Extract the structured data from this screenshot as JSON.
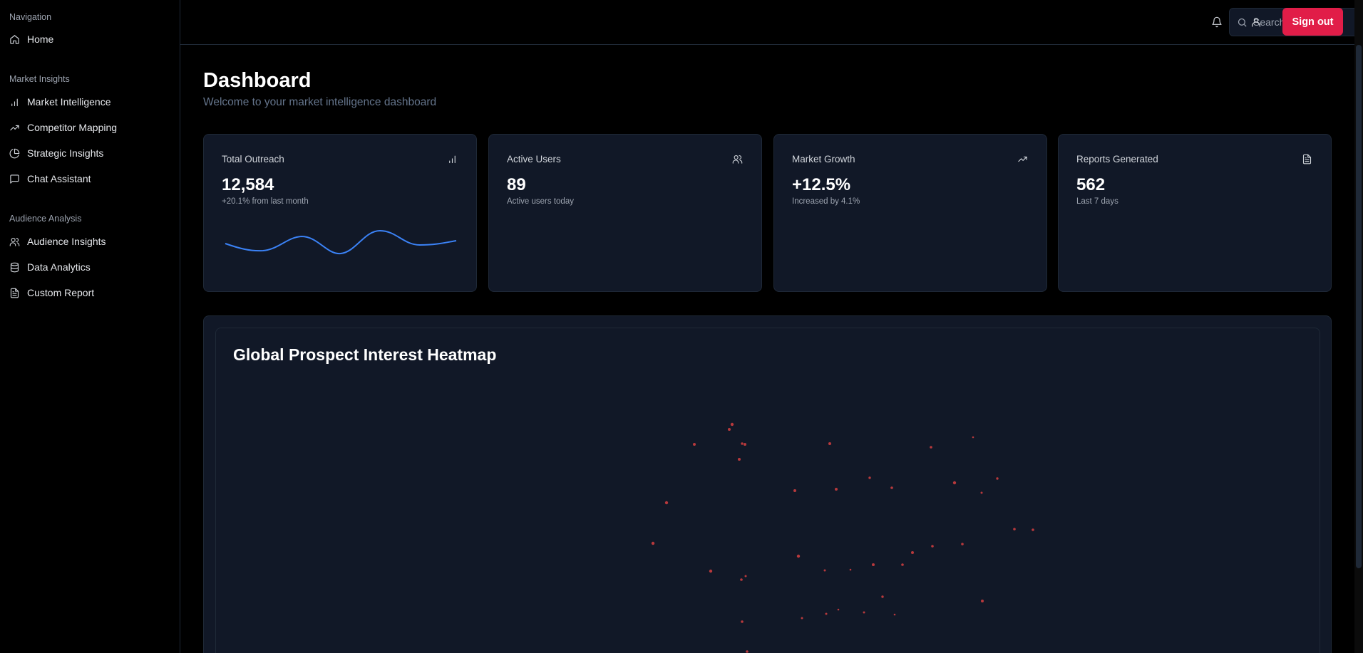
{
  "sidebar": {
    "groups": [
      {
        "title": "Navigation",
        "items": [
          {
            "label": "Home",
            "icon": "home-icon"
          }
        ]
      },
      {
        "title": "Market Insights",
        "items": [
          {
            "label": "Market Intelligence",
            "icon": "bar-chart-icon"
          },
          {
            "label": "Competitor Mapping",
            "icon": "trending-up-icon"
          },
          {
            "label": "Strategic Insights",
            "icon": "pie-chart-icon"
          },
          {
            "label": "Chat Assistant",
            "icon": "message-square-icon"
          }
        ]
      },
      {
        "title": "Audience Analysis",
        "items": [
          {
            "label": "Audience Insights",
            "icon": "users-icon"
          },
          {
            "label": "Data Analytics",
            "icon": "database-icon"
          },
          {
            "label": "Custom Report",
            "icon": "file-text-icon"
          }
        ]
      }
    ]
  },
  "topbar": {
    "search_placeholder": "Search...",
    "signout_label": "Sign out"
  },
  "page": {
    "title": "Dashboard",
    "subtitle": "Welcome to your market intelligence dashboard"
  },
  "cards": [
    {
      "title": "Total Outreach",
      "value": "12,584",
      "sub": "+20.1% from last month",
      "icon": "bar-chart-icon"
    },
    {
      "title": "Active Users",
      "value": "89",
      "sub": "Active users today",
      "icon": "users-icon"
    },
    {
      "title": "Market Growth",
      "value": "+12.5%",
      "sub": "Increased by 4.1%",
      "icon": "trending-up-icon"
    },
    {
      "title": "Reports Generated",
      "value": "562",
      "sub": "Last 7 days",
      "icon": "file-text-icon"
    }
  ],
  "heatmap": {
    "title": "Global Prospect Interest Heatmap"
  },
  "colors": {
    "accent": "#e11d48",
    "sparkline": "#3b82f6",
    "heat_point": "#ef4444",
    "card_bg": "#111827"
  }
}
